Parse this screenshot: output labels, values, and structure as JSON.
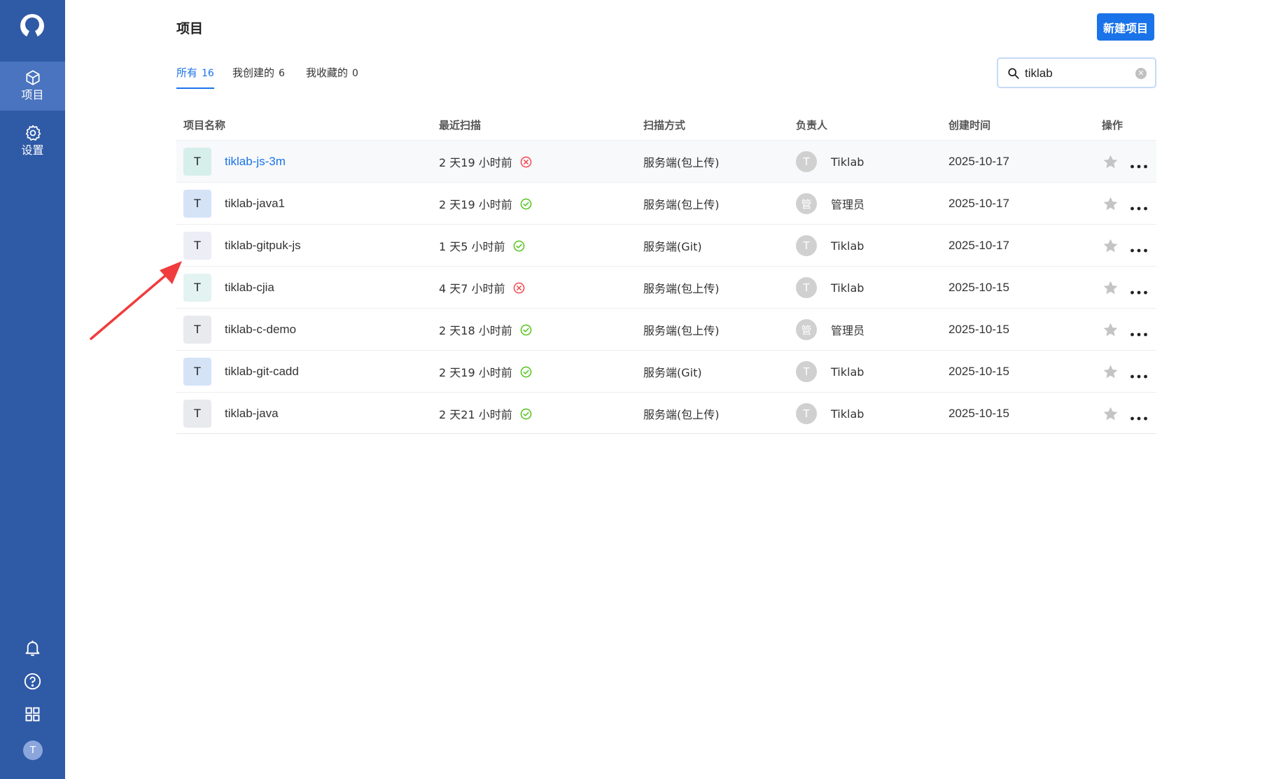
{
  "sidebar": {
    "nav": [
      {
        "label": "项目",
        "icon": "cube-icon",
        "active": true
      },
      {
        "label": "设置",
        "icon": "gear-icon",
        "active": false
      }
    ],
    "bottom_icons": [
      "bell-icon",
      "help-icon",
      "apps-grid-icon"
    ],
    "avatar_letter": "T",
    "accent": "#2f5aa6"
  },
  "header": {
    "title": "项目",
    "new_button": "新建项目"
  },
  "tabs": [
    {
      "label": "所有",
      "count": "16",
      "active": true
    },
    {
      "label": "我创建的",
      "count": "6",
      "active": false
    },
    {
      "label": "我收藏的",
      "count": "0",
      "active": false
    }
  ],
  "search": {
    "value": "tiklab",
    "placeholder": ""
  },
  "table": {
    "headers": [
      "项目名称",
      "最近扫描",
      "扫描方式",
      "负责人",
      "创建时间",
      "操作"
    ],
    "rows": [
      {
        "badge": "T",
        "badge_color": "#d6efeb",
        "name": "tiklab-js-3m",
        "scan": "2 天19 小时前",
        "status": "fail",
        "method": "服务端(包上传)",
        "owner_avatar": "T",
        "owner": "Tiklab",
        "date": "2025-10-17"
      },
      {
        "badge": "T",
        "badge_color": "#d5e3f7",
        "name": "tiklab-java1",
        "scan": "2 天19 小时前",
        "status": "success",
        "method": "服务端(包上传)",
        "owner_avatar": "管",
        "owner": "管理员",
        "date": "2025-10-17"
      },
      {
        "badge": "T",
        "badge_color": "#ecedf5",
        "name": "tiklab-gitpuk-js",
        "scan": "1 天5 小时前",
        "status": "success",
        "method": "服务端(Git)",
        "owner_avatar": "T",
        "owner": "Tiklab",
        "date": "2025-10-17"
      },
      {
        "badge": "T",
        "badge_color": "#e3f3f2",
        "name": "tiklab-cjia",
        "scan": "4 天7 小时前",
        "status": "fail",
        "method": "服务端(包上传)",
        "owner_avatar": "T",
        "owner": "Tiklab",
        "date": "2025-10-15"
      },
      {
        "badge": "T",
        "badge_color": "#e8eaee",
        "name": "tiklab-c-demo",
        "scan": "2 天18 小时前",
        "status": "success",
        "method": "服务端(包上传)",
        "owner_avatar": "管",
        "owner": "管理员",
        "date": "2025-10-15"
      },
      {
        "badge": "T",
        "badge_color": "#d5e3f7",
        "name": "tiklab-git-cadd",
        "scan": "2 天19 小时前",
        "status": "success",
        "method": "服务端(Git)",
        "owner_avatar": "T",
        "owner": "Tiklab",
        "date": "2025-10-15"
      },
      {
        "badge": "T",
        "badge_color": "#e8eaee",
        "name": "tiklab-java",
        "scan": "2 天21 小时前",
        "status": "success",
        "method": "服务端(包上传)",
        "owner_avatar": "T",
        "owner": "Tiklab",
        "date": "2025-10-15"
      }
    ]
  },
  "colors": {
    "link": "#1a73e8",
    "success": "#52c41a",
    "fail": "#f5474c",
    "annotation_arrow": "#f03c3c"
  }
}
